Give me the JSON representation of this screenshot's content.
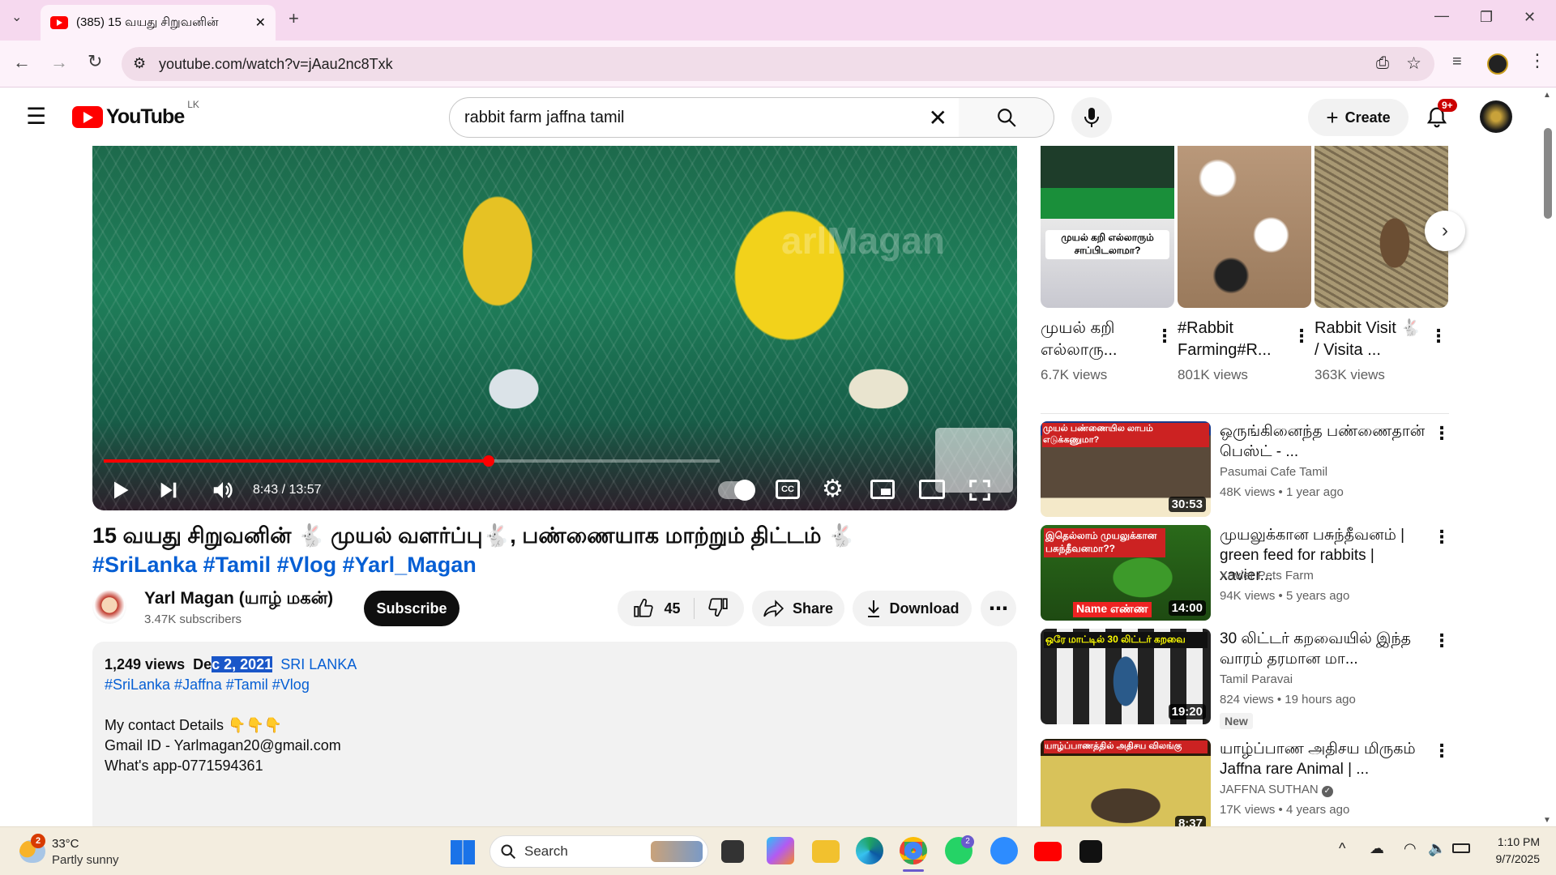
{
  "browser": {
    "tab_title": "(385) 15 வயது சிறுவனின்",
    "url": "youtube.com/watch?v=jAau2nc8Txk"
  },
  "header": {
    "logo_text": "YouTube",
    "country": "LK",
    "search_value": "rabbit farm jaffna tamil",
    "create_label": "Create",
    "notif_count": "9+"
  },
  "player": {
    "time": "8:43 / 13:57",
    "progress": 0.625
  },
  "video": {
    "title": "15 வயது சிறுவனின் 🐇 முயல் வளர்ப்பு🐇, பண்ணையாக மாற்றும் திட்டம் 🐇",
    "hashtags": "#SriLanka #Tamil #Vlog #Yarl_Magan",
    "channel": "Yarl Magan (யாழ் மகன்)",
    "subscribers": "3.47K subscribers",
    "subscribe_label": "Subscribe",
    "likes": "45",
    "share_label": "Share",
    "download_label": "Download"
  },
  "description": {
    "views": "1,249 views",
    "date_prefix": "De",
    "date_highlight": "c 2, 2021",
    "location": "SRI LANKA",
    "tags": "#SriLanka #Jaffna #Tamil #Vlog",
    "line1": "My contact  Details 👇👇👇",
    "line2": "Gmail ID - Yarlmagan20@gmail.com",
    "line3": "What's app-0771594361"
  },
  "shorts": [
    {
      "title": "முயல் கறி எல்லாரு...",
      "views": "6.7K views",
      "thumb_text": "முயல் கறி எல்லாரும் சாப்பிடலாமா?"
    },
    {
      "title": "#Rabbit Farming#R...",
      "views": "801K views"
    },
    {
      "title": "Rabbit Visit 🐇 / Visita ...",
      "views": "363K views"
    }
  ],
  "related": [
    {
      "title": "ஒருங்கினைந்த பண்ணைதான் பெஸ்ட் - ...",
      "channel": "Pasumai Cafe Tamil",
      "meta": "48K views • 1 year ago",
      "duration": "30:53",
      "thumb_text": "முயல் பண்ணையில லாபம் எடுக்கணுமா?"
    },
    {
      "title": "முயலுக்கான பசுந்தீவனம் | green feed for rabbits | xavier...",
      "channel": "Xavier Pets Farm",
      "meta": "94K views • 5 years ago",
      "duration": "14:00",
      "thumb_text": "இதெல்லாம் முயலுக்கான பசுந்தீவனமா??",
      "thumb_text2": "Name எண்ண"
    },
    {
      "title": "30 லிட்டர் கறவையில் இந்த வாரம் தரமான மா...",
      "channel": "Tamil Paravai",
      "meta": "824 views • 19 hours ago",
      "duration": "19:20",
      "badge": "New",
      "thumb_text": "ஒரே மாட்டில் 30 லிட்டர் கறவை"
    },
    {
      "title": "யாழ்ப்பாண அதிசய மிருகம் Jaffna rare Animal | ...",
      "channel": "JAFFNA SUTHAN",
      "meta": "17K views • 4 years ago",
      "duration": "8:37",
      "thumb_text": "யாழ்ப்பாணத்தில் அதிசய விலங்கு"
    }
  ],
  "taskbar": {
    "temp": "33°C",
    "weather": "Partly sunny",
    "weather_badge": "2",
    "search_label": "Search",
    "time": "1:10 PM",
    "date": "9/7/2025",
    "whatsapp_badge": "2"
  },
  "colors": {
    "youtube_red": "#ff0000",
    "link_blue": "#065fd4",
    "tab_bar": "#f6d9ef"
  }
}
